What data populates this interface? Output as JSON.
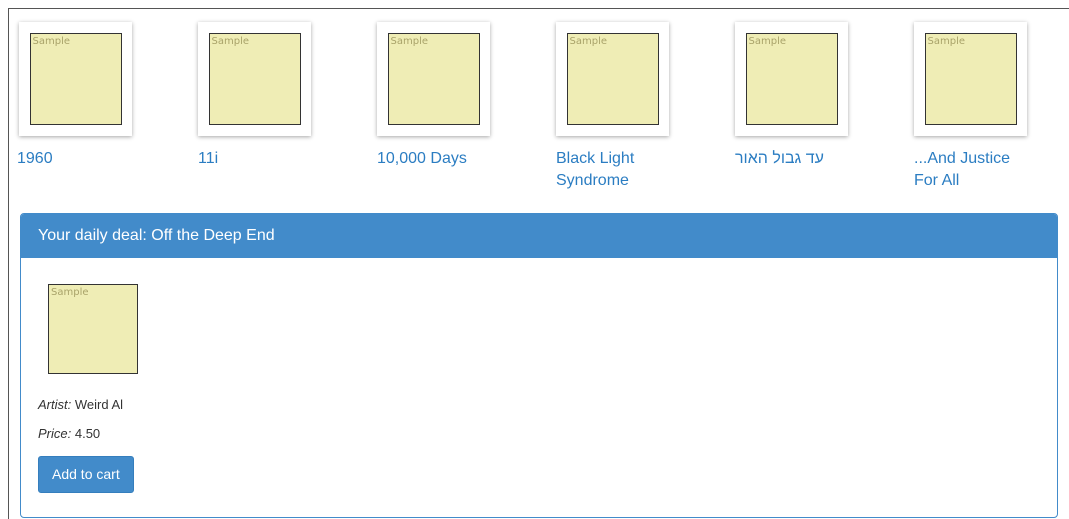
{
  "albums": [
    {
      "title": "1960",
      "art_label": "Sample"
    },
    {
      "title": "11i",
      "art_label": "Sample"
    },
    {
      "title": "10,000 Days",
      "art_label": "Sample"
    },
    {
      "title": "Black Light Syndrome",
      "art_label": "Sample"
    },
    {
      "title": "עד גבול האור",
      "art_label": "Sample"
    },
    {
      "title": "...And Justice For All",
      "art_label": "Sample"
    }
  ],
  "deal": {
    "heading": "Your daily deal: Off the Deep End",
    "art_label": "Sample",
    "artist_label": "Artist:",
    "artist": "Weird Al",
    "price_label": "Price:",
    "price": "4.50",
    "add_to_cart": "Add to cart"
  },
  "colors": {
    "link": "#2b7dc2",
    "panel": "#428bca",
    "album_art": "#efedb5"
  }
}
